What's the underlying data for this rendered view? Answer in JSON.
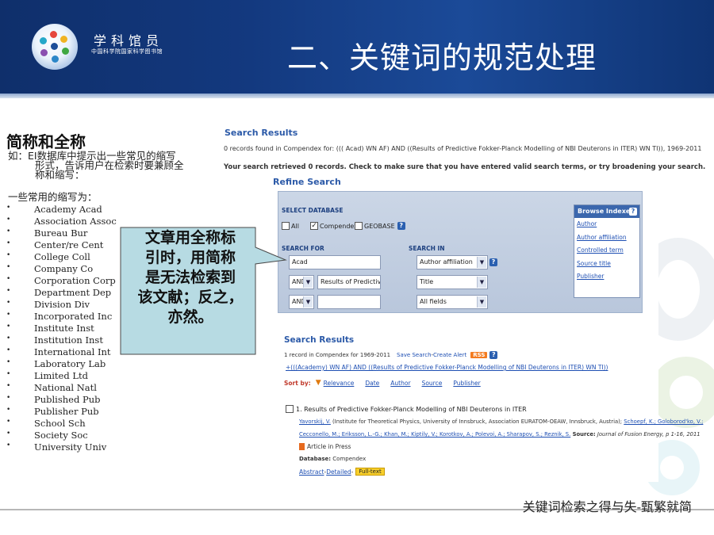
{
  "header": {
    "brand_name": "学科馆员",
    "brand_sub": "中国科学院国家科学图书馆",
    "title": "二、关键词的规范处理"
  },
  "left": {
    "heading": "简称和全称",
    "intro_line1": "如：EI数据库中提示出一些常见的缩写",
    "intro_line2": "形式，告诉用户在检索时要兼顾全",
    "intro_line3": "称和缩写：",
    "common_label": "一些常用的缩写为：",
    "bullet": "•",
    "abbreviations": [
      "Academy Acad",
      "Association Assoc",
      "Bureau Bur",
      "Center/re Cent",
      "College Coll",
      "Company Co",
      "Corporation Corp",
      "Department Dep",
      "Division Div",
      "Incorporated Inc",
      "Institute Inst",
      "Institution Inst",
      "International Int",
      "Laboratory Lab",
      "Limited Ltd",
      "National Natl",
      "Published Pub",
      "Publisher Pub",
      "School Sch",
      "Society Soc",
      "University Univ"
    ]
  },
  "callout": {
    "line1": "文章用全称标",
    "line2": "引时，用简称",
    "line3": "是无法检索到",
    "line4": "该文献；反之，",
    "line5": "亦然。"
  },
  "screenshot": {
    "search_results_title": "Search Results",
    "records_found": "0 records found in Compendex for: ((( Acad) WN AF) AND ((Results of Predictive Fokker-Planck Modelling of NBI Deuterons in ITER) WN TI)), 1969-2011",
    "retrieved_msg": "Your search retrieved 0 records. Check to make sure that you have entered valid search terms, or try broadening your search.",
    "refine_title": "Refine Search",
    "select_database_label": "SELECT DATABASE",
    "db_all": "All",
    "db_compendex": "Compendex",
    "db_geobase": "GEOBASE",
    "help_glyph": "?",
    "check_glyph": "✓",
    "search_for_label": "SEARCH FOR",
    "search_in_label": "SEARCH IN",
    "rows": [
      {
        "term": "Acad",
        "field": "Author affiliation"
      },
      {
        "op": "AND",
        "term": "Results of Predictive",
        "field": "Title"
      },
      {
        "op": "AND",
        "term": "",
        "field": "All fields"
      }
    ],
    "browse_indexes_title": "Browse Indexes",
    "browse_items": [
      "Author",
      "Author affiliation",
      "Controlled term",
      "Source title",
      "Publisher"
    ],
    "results_title": "Search Results",
    "results_count": "1 record in Compendex for 1969-2011",
    "save_search": "Save Search",
    "create_alert": "Create Alert",
    "rss": "RSS",
    "query": "+(((Academy) WN AF) AND ((Results of Predictive Fokker-Planck Modelling of NBI Deuterons in ITER) WN TI))",
    "sort_by": "Sort by:",
    "sort_options": [
      "Relevance",
      "Date",
      "Author",
      "Source",
      "Publisher"
    ],
    "record_title": "1. Results of Predictive Fokker-Planck Modelling of NBI Deuterons in ITER",
    "record_authors_1_name": "Yavorskij, V.",
    "record_authors_1_rest": " (Institute for Theoretical Physics, University of Innsbruck, Association EURATOM-OEAW, Innsbruck, Austria); ",
    "record_authors_1_tail": "Schoepf, K.; Goloborod'ko, V.;",
    "record_authors_2": "Cecconello, M.; Eriksson, L.-G.; Khan, M.; Kiptily, V.; Korotkov, A.; Polevoi, A.; Sharapov, S.; Reznik, S.",
    "record_source_label": " Source:",
    "record_source": " Journal of Fusion Energy, p 1-16, 2011",
    "article_in_press": "Article in Press",
    "database_label": "Database:",
    "database_value": " Compendex",
    "abstract_link": "Abstract",
    "detailed_link": "Detailed",
    "fulltext": "Full-text",
    "link_sep": " - "
  },
  "footer": {
    "text": "关键词检索之得与失-甄繁就简"
  },
  "colors": {
    "header_blue": "#13397f",
    "link_blue": "#1e4fb3",
    "callout_fill": "#b7dbe3",
    "rss_orange": "#f47c20",
    "fulltext_yellow": "#f8cf2c"
  }
}
